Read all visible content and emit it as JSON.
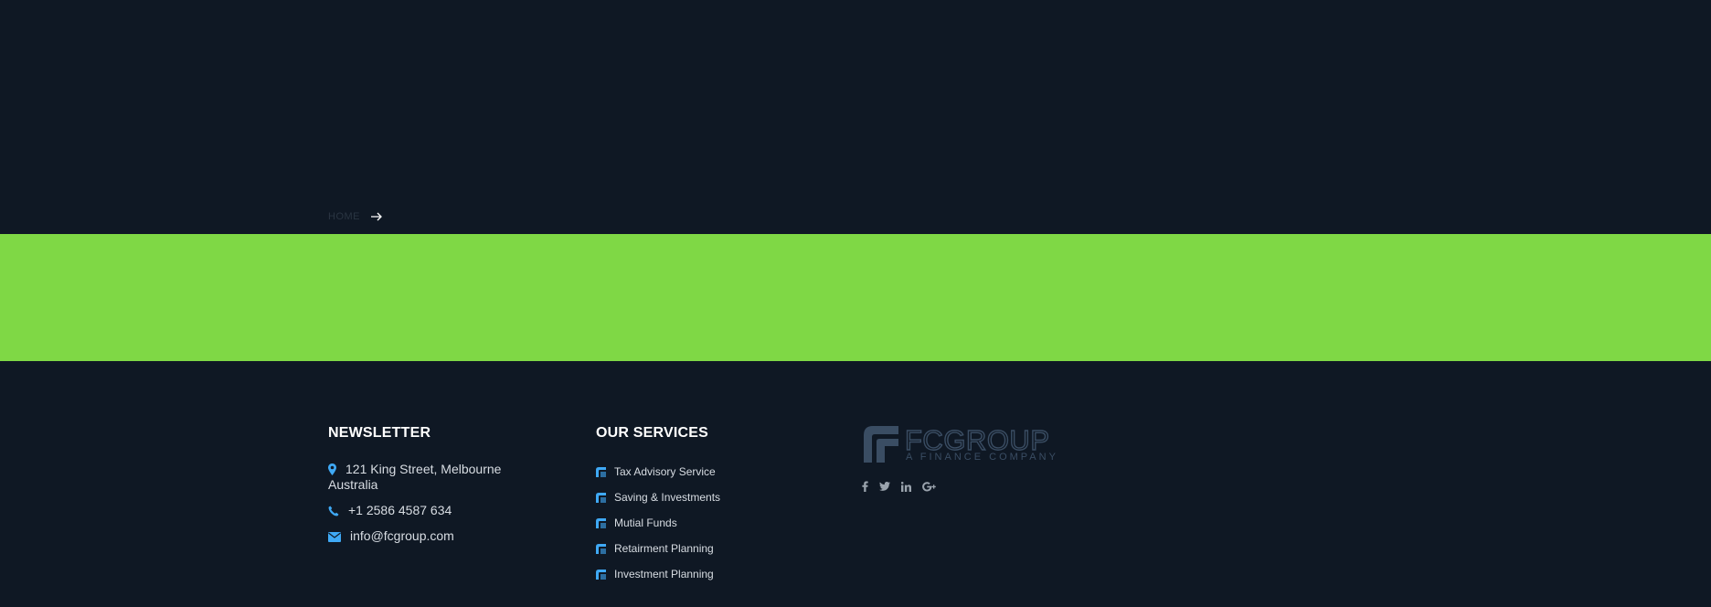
{
  "breadcrumb": {
    "home": "HOME"
  },
  "footer": {
    "newsletter": {
      "heading": "NEWSLETTER",
      "address_line1": "121 King Street, Melbourne",
      "address_line2": "Australia",
      "phone": "+1 2586 4587 634",
      "email": "info@fcgroup.com"
    },
    "services": {
      "heading": "OUR SERVICES",
      "items": [
        {
          "label": "Tax Advisory Service"
        },
        {
          "label": "Saving & Investments"
        },
        {
          "label": "Mutial Funds"
        },
        {
          "label": "Retairment Planning"
        },
        {
          "label": "Investment Planning"
        }
      ]
    },
    "brand": {
      "name": "FCGROUP",
      "tagline": "A FINANCE COMPANY",
      "social": [
        "facebook-icon",
        "twitter-icon",
        "linkedin-icon",
        "google-plus-icon"
      ]
    }
  },
  "colors": {
    "background": "#0f1824",
    "accent_band": "#7fd845",
    "icon_blue": "#3fa9f5",
    "logo": "#3a4d63"
  }
}
